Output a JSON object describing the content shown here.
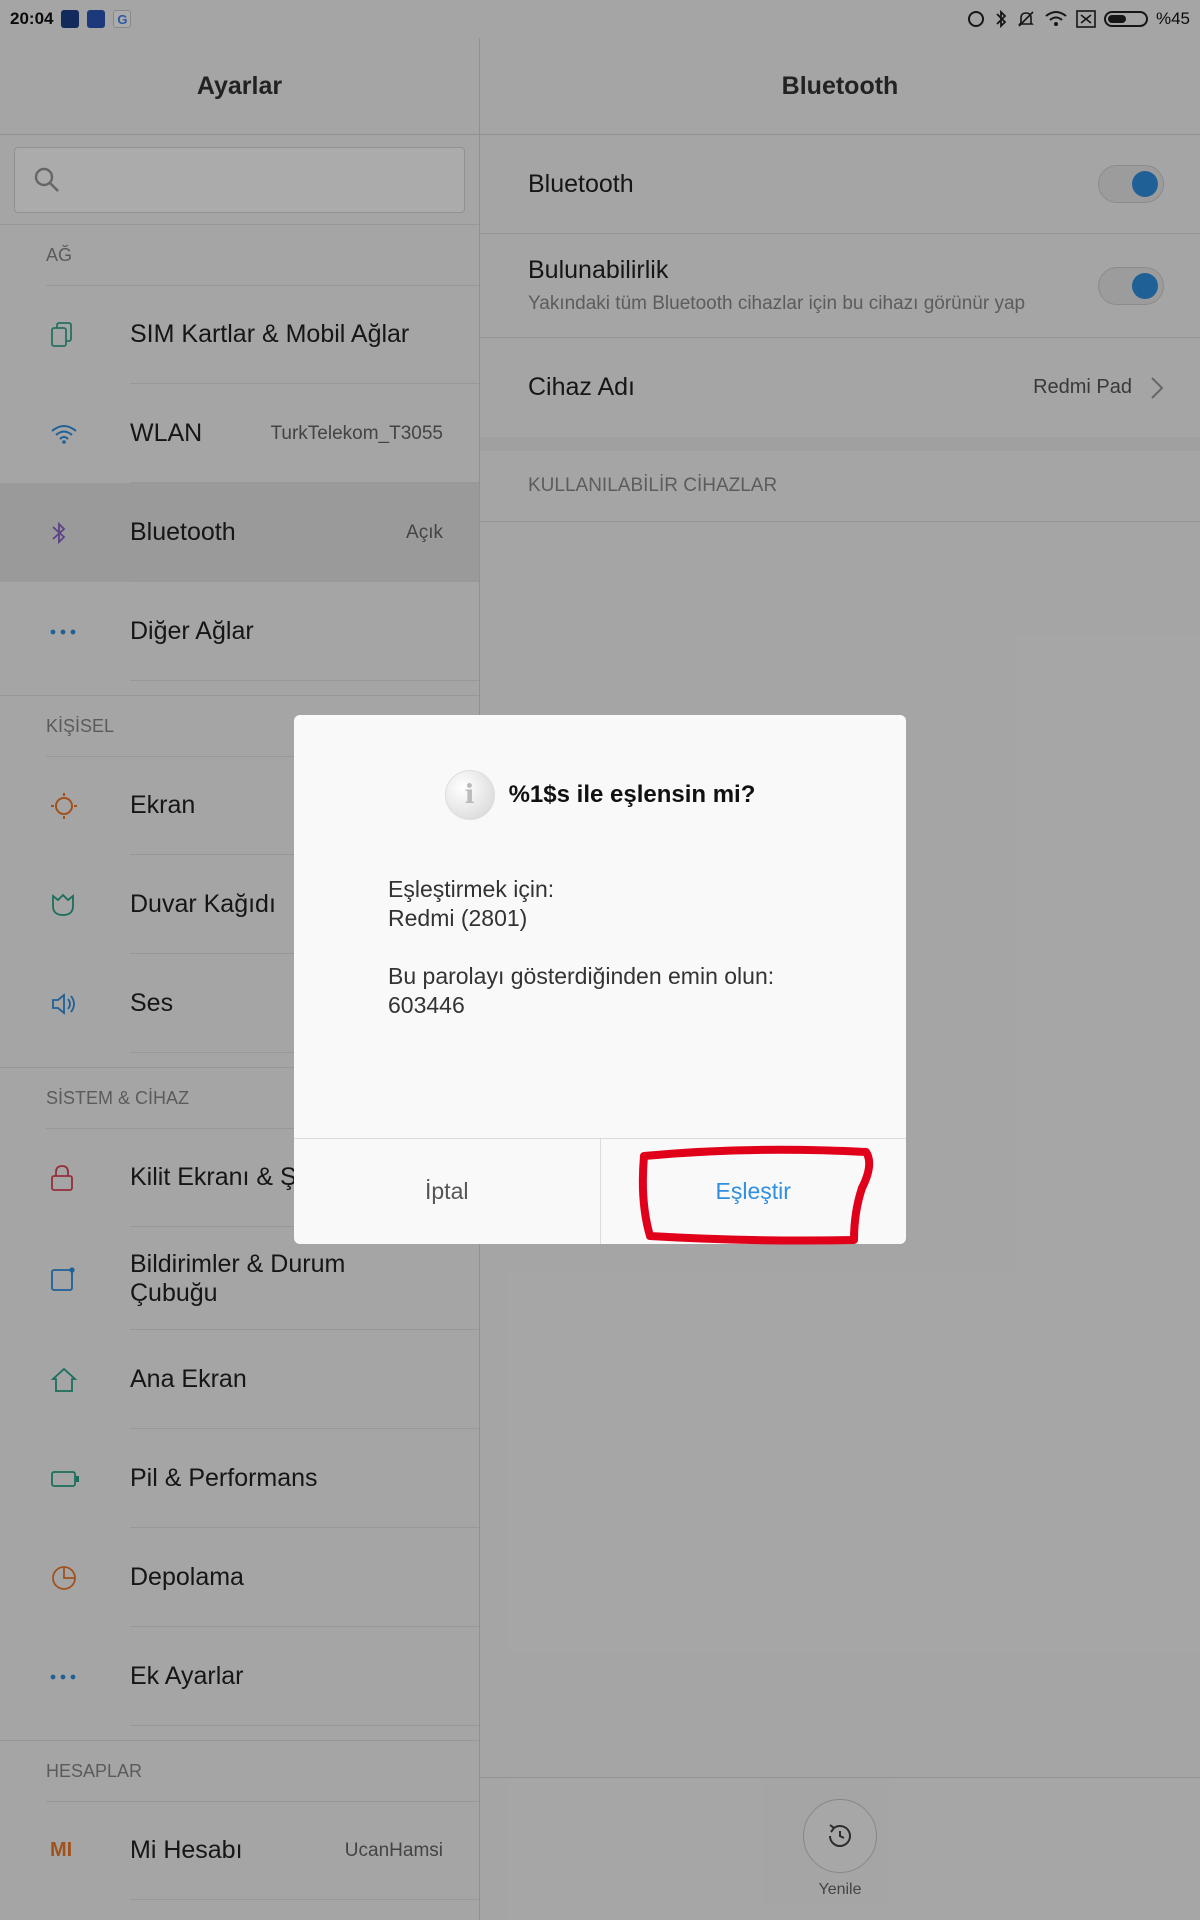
{
  "status_bar": {
    "time": "20:04",
    "battery": "%45",
    "icons": [
      "sync-icon",
      "bluetooth-icon",
      "mute-icon",
      "wifi-icon",
      "no-sim-icon",
      "battery-icon"
    ]
  },
  "left": {
    "title": "Ayarlar",
    "search_placeholder": "",
    "sections": {
      "network": "AĞ",
      "personal": "KİŞİSEL",
      "system": "SİSTEM & CİHAZ",
      "accounts": "HESAPLAR"
    },
    "items": {
      "sim": {
        "label": "SIM Kartlar & Mobil Ağlar"
      },
      "wlan": {
        "label": "WLAN",
        "value": "TurkTelekom_T3055"
      },
      "bluetooth": {
        "label": "Bluetooth",
        "value": "Açık"
      },
      "other_networks": {
        "label": "Diğer Ağlar"
      },
      "display": {
        "label": "Ekran"
      },
      "wallpaper": {
        "label": "Duvar Kağıdı"
      },
      "sound": {
        "label": "Ses"
      },
      "lock": {
        "label": "Kilit Ekranı & Şi"
      },
      "notifications": {
        "label_line1": "Bildirimler & Durum",
        "label_line2": "Çubuğu"
      },
      "home": {
        "label": "Ana Ekran"
      },
      "battery": {
        "label": "Pil & Performans"
      },
      "storage": {
        "label": "Depolama"
      },
      "additional": {
        "label": "Ek Ayarlar"
      },
      "mi_account": {
        "label": "Mi Hesabı",
        "value": "UcanHamsi"
      }
    }
  },
  "right": {
    "title": "Bluetooth",
    "bluetooth_row": {
      "label": "Bluetooth",
      "on": true
    },
    "visibility_row": {
      "label": "Bulunabilirlik",
      "sub": "Yakındaki tüm Bluetooth cihazlar için bu cihazı görünür yap",
      "on": true
    },
    "device_name_row": {
      "label": "Cihaz Adı",
      "value": "Redmi Pad"
    },
    "available_section": "KULLANILABİLİR CİHAZLAR",
    "refresh_label": "Yenile"
  },
  "dialog": {
    "icon_glyph": "i",
    "title": "%1$s ile eşlensin mi?",
    "line1": "Eşleştirmek için:",
    "line2": "Redmi (2801)",
    "line3": "Bu parolayı gösterdiğinden emin olun:",
    "line4": "603446",
    "cancel": "İptal",
    "confirm": "Eşleştir"
  },
  "colors": {
    "accent": "#2f8fe0",
    "annotation": "#e0001a"
  }
}
